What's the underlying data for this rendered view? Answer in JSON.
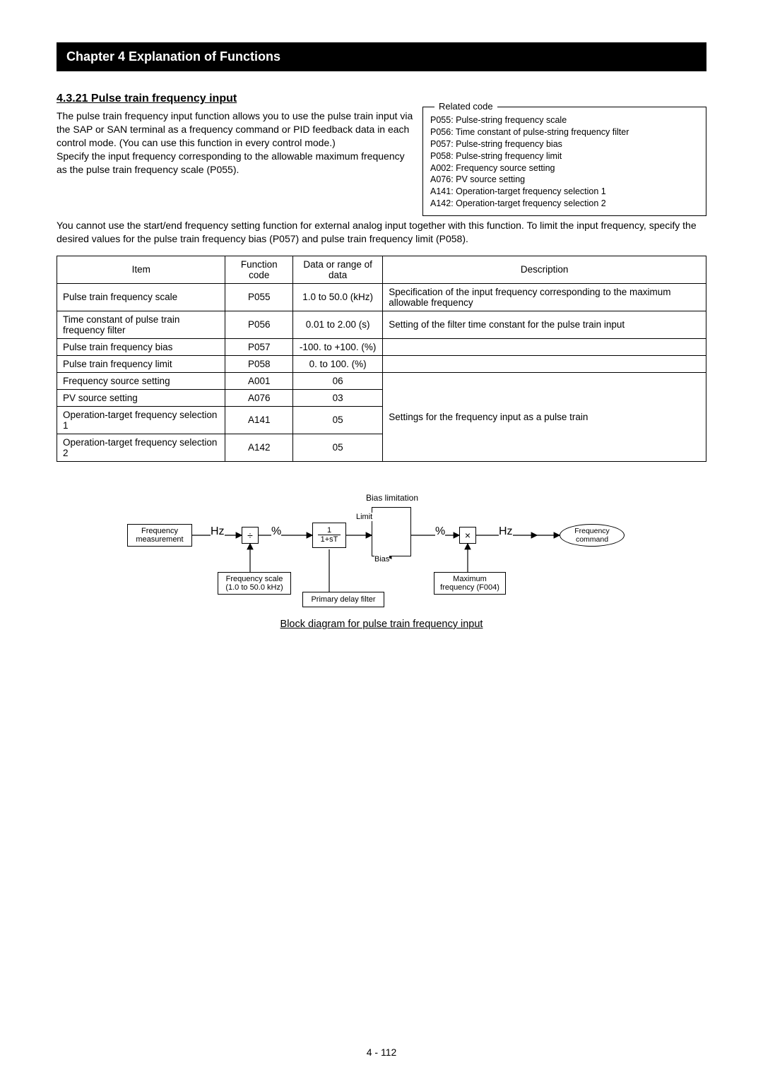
{
  "chapter_bar": "Chapter 4 Explanation of Functions",
  "section_title": "4.3.21 Pulse train frequency input",
  "intro_para1": "The pulse train frequency input function allows you to use the pulse train input via the SAP or SAN terminal as a frequency command or PID feedback data in each control mode. (You can use this function in every control mode.)",
  "intro_para2": "Specify the input frequency corresponding to the allowable maximum frequency as the pulse train frequency scale (P055).",
  "after_para": "You cannot use the start/end frequency setting function for external analog input together with this function. To limit the input frequency, specify the desired values for the pulse train frequency bias (P057) and pulse train frequency limit (P058).",
  "related": {
    "legend": "Related code",
    "items": [
      "P055: Pulse-string frequency scale",
      "P056: Time constant of pulse-string frequency filter",
      "P057: Pulse-string frequency bias",
      "P058: Pulse-string frequency limit",
      "A002: Frequency source setting",
      "A076: PV source setting",
      "A141: Operation-target frequency selection 1",
      "A142: Operation-target frequency selection 2"
    ]
  },
  "table": {
    "headers": {
      "item": "Item",
      "code": "Function code",
      "range": "Data or range of data",
      "desc": "Description"
    },
    "rows": [
      {
        "item": "Pulse train frequency scale",
        "code": "P055",
        "range": "1.0 to 50.0 (kHz)",
        "desc": "Specification of the input frequency corresponding to the maximum allowable frequency"
      },
      {
        "item": "Time constant of pulse train frequency filter",
        "code": "P056",
        "range": "0.01 to 2.00 (s)",
        "desc": "Setting of the filter time constant for the pulse train input"
      },
      {
        "item": "Pulse train frequency bias",
        "code": "P057",
        "range": "-100. to +100. (%)",
        "desc": ""
      },
      {
        "item": "Pulse train frequency limit",
        "code": "P058",
        "range": "0. to 100. (%)",
        "desc": ""
      },
      {
        "item": "Frequency source setting",
        "code": "A001",
        "range": "06",
        "desc": ""
      },
      {
        "item": "PV source setting",
        "code": "A076",
        "range": "03",
        "desc": ""
      },
      {
        "item": "Operation-target frequency selection 1",
        "code": "A141",
        "range": "05",
        "desc": ""
      },
      {
        "item": "Operation-target frequency selection 2",
        "code": "A142",
        "range": "05",
        "desc": ""
      }
    ],
    "desc_merge": "Settings for the frequency input as a pulse train"
  },
  "diagram": {
    "bias_limitation": "Bias limitation",
    "limit": "Limit",
    "bias": "Bias",
    "freq_meas": "Frequency measurement",
    "hz1": "Hz",
    "pct1": "%",
    "divide": "÷",
    "filter_top": "1",
    "filter_bot": "1+sT",
    "pct2": "%",
    "multiply": "×",
    "hz2": "Hz",
    "freq_cmd": "Frequency command",
    "freq_scale": "Frequency scale (1.0 to 50.0 kHz)",
    "primary_delay": "Primary delay filter",
    "max_freq": "Maximum frequency (F004)",
    "caption": "Block diagram for pulse train frequency input"
  },
  "page_number": "4 - 112"
}
